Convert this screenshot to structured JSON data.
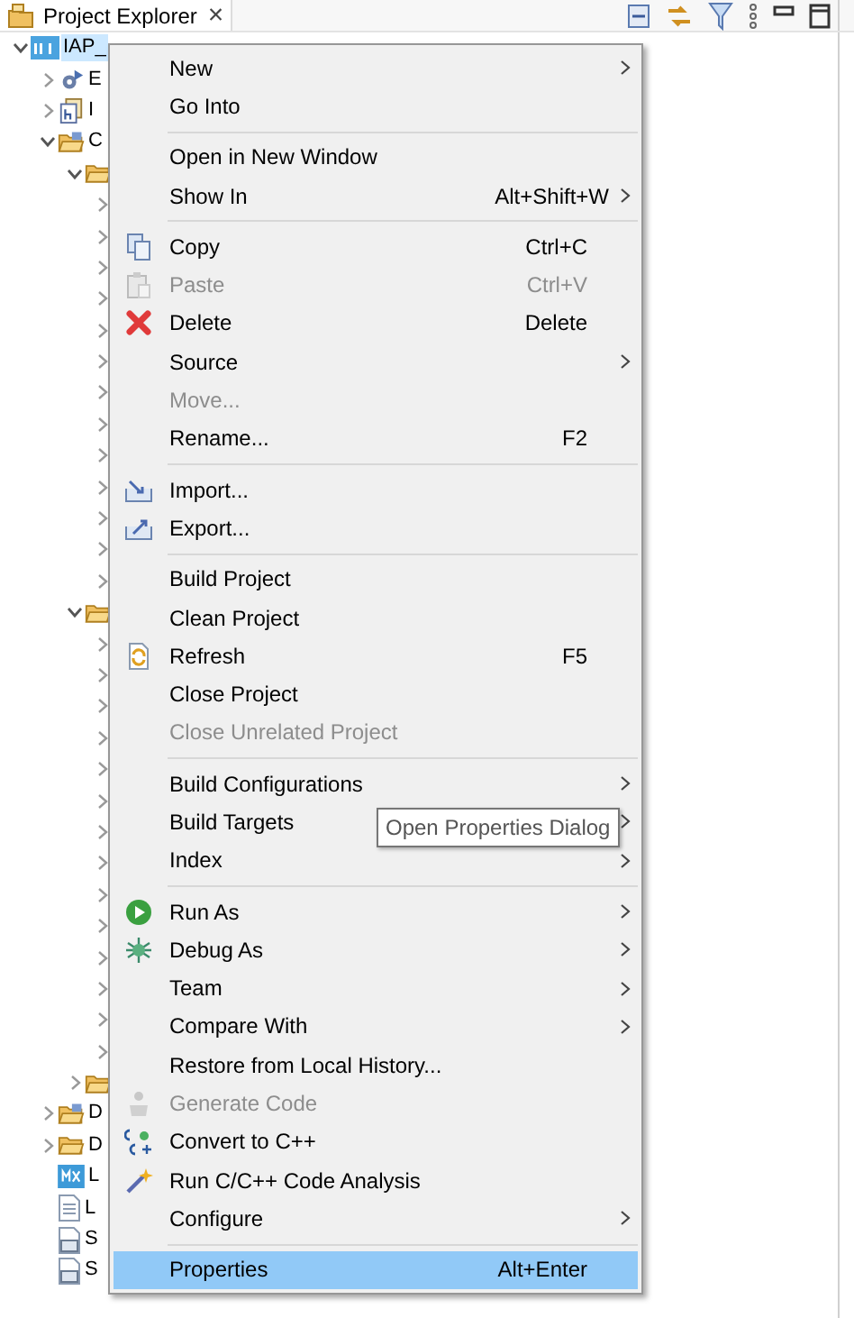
{
  "view_tab": {
    "title": "Project Explorer",
    "close": "×"
  },
  "tree": [
    {
      "label": "IAP_",
      "kind": "project",
      "selected": true,
      "expanded": true,
      "children": [
        {
          "label": "E",
          "kind": "binaries",
          "expanded": false
        },
        {
          "label": "I",
          "kind": "includes",
          "expanded": false
        },
        {
          "label": "C",
          "kind": "source",
          "expanded": true,
          "children": [
            {
              "kind": "folder",
              "expanded": true,
              "children": [
                {
                  "expanded": false
                },
                {
                  "expanded": false
                },
                {
                  "expanded": false
                },
                {
                  "expanded": false
                },
                {
                  "expanded": false
                },
                {
                  "expanded": false
                },
                {
                  "expanded": false
                },
                {
                  "expanded": false
                },
                {
                  "expanded": false
                },
                {
                  "expanded": false
                },
                {
                  "expanded": false
                },
                {
                  "expanded": false
                },
                {
                  "expanded": false
                }
              ]
            },
            {
              "kind": "folder",
              "expanded": true,
              "children": [
                {
                  "expanded": false
                },
                {
                  "expanded": false
                },
                {
                  "expanded": false
                },
                {
                  "expanded": false
                },
                {
                  "expanded": false
                },
                {
                  "expanded": false
                },
                {
                  "expanded": false
                },
                {
                  "expanded": false
                },
                {
                  "expanded": false
                },
                {
                  "expanded": false
                },
                {
                  "expanded": false
                },
                {
                  "expanded": false
                },
                {
                  "expanded": false
                },
                {
                  "expanded": false
                }
              ]
            },
            {
              "kind": "folder",
              "expanded": false
            }
          ]
        },
        {
          "label": "D",
          "kind": "source",
          "expanded": false
        },
        {
          "label": "D",
          "kind": "folder",
          "expanded": false
        },
        {
          "label": "L",
          "kind": "mx"
        },
        {
          "label": "L",
          "kind": "file"
        },
        {
          "label": "S",
          "kind": "ld"
        },
        {
          "label": "S",
          "kind": "ld"
        }
      ]
    }
  ],
  "context_menu": {
    "items": [
      {
        "kind": "item",
        "label": "New",
        "submenu": true,
        "disabled": false,
        "selected": false
      },
      {
        "kind": "item",
        "label": "Go Into",
        "submenu": false,
        "disabled": false,
        "selected": false
      },
      {
        "kind": "separator"
      },
      {
        "kind": "item",
        "label": "Open in New Window",
        "submenu": false,
        "disabled": false,
        "selected": false
      },
      {
        "kind": "item",
        "label": "Show In",
        "shortcut": "Alt+Shift+W",
        "submenu": true,
        "disabled": false,
        "selected": false
      },
      {
        "kind": "separator"
      },
      {
        "kind": "item",
        "label": "Copy",
        "shortcut": "Ctrl+C",
        "submenu": false,
        "disabled": false,
        "selected": false
      },
      {
        "kind": "item",
        "label": "Paste",
        "shortcut": "Ctrl+V",
        "submenu": false,
        "disabled": true,
        "selected": false
      },
      {
        "kind": "item",
        "label": "Delete",
        "shortcut": "Delete",
        "submenu": false,
        "disabled": false,
        "selected": false
      },
      {
        "kind": "item",
        "label": "Source",
        "submenu": true,
        "disabled": false,
        "selected": false
      },
      {
        "kind": "item",
        "label": "Move...",
        "submenu": false,
        "disabled": true,
        "selected": false
      },
      {
        "kind": "item",
        "label": "Rename...",
        "shortcut": "F2",
        "submenu": false,
        "disabled": false,
        "selected": false
      },
      {
        "kind": "separator"
      },
      {
        "kind": "item",
        "label": "Import...",
        "submenu": false,
        "disabled": false,
        "selected": false
      },
      {
        "kind": "item",
        "label": "Export...",
        "submenu": false,
        "disabled": false,
        "selected": false
      },
      {
        "kind": "separator"
      },
      {
        "kind": "item",
        "label": "Build Project",
        "submenu": false,
        "disabled": false,
        "selected": false
      },
      {
        "kind": "item",
        "label": "Clean Project",
        "submenu": false,
        "disabled": false,
        "selected": false
      },
      {
        "kind": "item",
        "label": "Refresh",
        "shortcut": "F5",
        "submenu": false,
        "disabled": false,
        "selected": false
      },
      {
        "kind": "item",
        "label": "Close Project",
        "submenu": false,
        "disabled": false,
        "selected": false
      },
      {
        "kind": "item",
        "label": "Close Unrelated Project",
        "submenu": false,
        "disabled": true,
        "selected": false
      },
      {
        "kind": "separator"
      },
      {
        "kind": "item",
        "label": "Build Configurations",
        "submenu": true,
        "disabled": false,
        "selected": false
      },
      {
        "kind": "item",
        "label": "Build Targets",
        "submenu": true,
        "disabled": false,
        "selected": false
      },
      {
        "kind": "item",
        "label": "Index",
        "submenu": true,
        "disabled": false,
        "selected": false
      },
      {
        "kind": "separator"
      },
      {
        "kind": "item",
        "label": "Run As",
        "submenu": true,
        "disabled": false,
        "selected": false
      },
      {
        "kind": "item",
        "label": "Debug As",
        "submenu": true,
        "disabled": false,
        "selected": false
      },
      {
        "kind": "item",
        "label": "Team",
        "submenu": true,
        "disabled": false,
        "selected": false
      },
      {
        "kind": "item",
        "label": "Compare With",
        "submenu": true,
        "disabled": false,
        "selected": false
      },
      {
        "kind": "item",
        "label": "Restore from Local History...",
        "submenu": false,
        "disabled": false,
        "selected": false
      },
      {
        "kind": "item",
        "label": "Generate Code",
        "submenu": false,
        "disabled": true,
        "selected": false
      },
      {
        "kind": "item",
        "label": "Convert to C++",
        "submenu": false,
        "disabled": false,
        "selected": false
      },
      {
        "kind": "item",
        "label": "Run C/C++ Code Analysis",
        "submenu": false,
        "disabled": false,
        "selected": false
      },
      {
        "kind": "item",
        "label": "Configure",
        "submenu": true,
        "disabled": false,
        "selected": false
      },
      {
        "kind": "separator"
      },
      {
        "kind": "item",
        "label": "Properties",
        "shortcut": "Alt+Enter",
        "submenu": false,
        "disabled": false,
        "selected": true
      }
    ]
  },
  "tooltip": {
    "text": "Open Properties Dialog"
  }
}
